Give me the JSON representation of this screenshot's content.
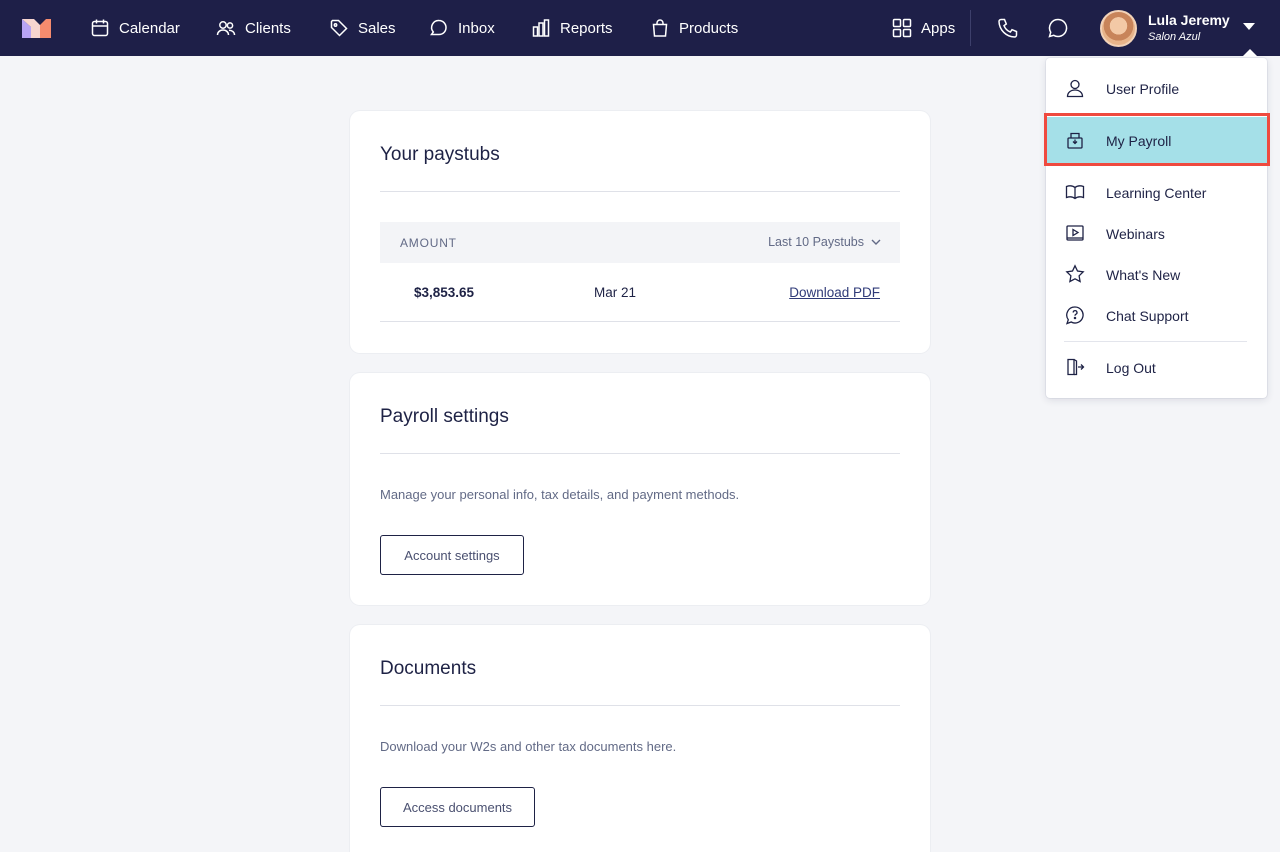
{
  "nav": {
    "items": [
      {
        "label": "Calendar",
        "icon": "calendar-icon"
      },
      {
        "label": "Clients",
        "icon": "clients-icon"
      },
      {
        "label": "Sales",
        "icon": "tag-icon"
      },
      {
        "label": "Inbox",
        "icon": "inbox-icon"
      },
      {
        "label": "Reports",
        "icon": "reports-icon"
      },
      {
        "label": "Products",
        "icon": "bag-icon"
      }
    ],
    "apps_label": "Apps",
    "user": {
      "name": "Lula Jeremy",
      "salon": "Salon Azul"
    }
  },
  "paystubs": {
    "title": "Your paystubs",
    "col_amount": "AMOUNT",
    "filter_label": "Last 10 Paystubs",
    "rows": [
      {
        "amount": "$3,853.65",
        "date": "Mar 21",
        "link": "Download PDF"
      }
    ]
  },
  "payroll_settings": {
    "title": "Payroll settings",
    "description": "Manage your personal info, tax details, and payment methods.",
    "button": "Account settings"
  },
  "documents": {
    "title": "Documents",
    "description": "Download your W2s and other tax documents here.",
    "button": "Access documents"
  },
  "menu": {
    "items": [
      {
        "label": "User Profile",
        "icon": "user-icon"
      },
      {
        "label": "My Payroll",
        "icon": "payroll-icon",
        "highlighted": true
      },
      {
        "label": "Learning Center",
        "icon": "book-icon"
      },
      {
        "label": "Webinars",
        "icon": "video-icon"
      },
      {
        "label": "What's New",
        "icon": "star-icon"
      },
      {
        "label": "Chat Support",
        "icon": "chat-support-icon"
      },
      {
        "label": "Log Out",
        "icon": "logout-icon"
      }
    ]
  },
  "colors": {
    "nav_bg": "#1e1f48",
    "page_bg": "#f4f5f8",
    "highlight_bg": "#a5e0e8",
    "highlight_border": "#ef4a3f",
    "link": "#2f3a78"
  }
}
